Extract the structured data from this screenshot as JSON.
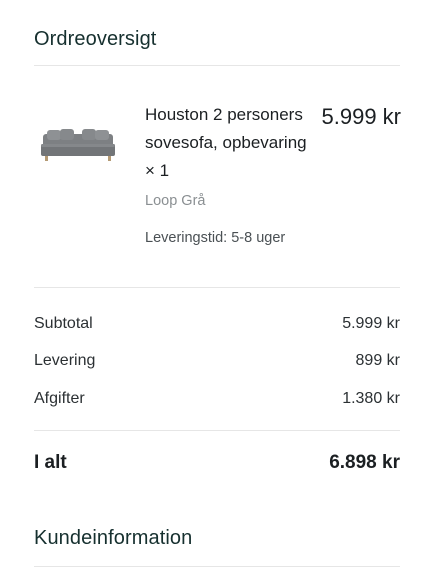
{
  "order_overview": {
    "title": "Ordreoversigt"
  },
  "product": {
    "image_icon": "sofa-bed-image",
    "name": "Houston 2 personers sovesofa, opbevaring × 1",
    "price": "5.999 kr",
    "variant": "Loop Grå",
    "delivery_time": "Leveringstid: 5-8 uger"
  },
  "summary": {
    "subtotal_label": "Subtotal",
    "subtotal_value": "5.999 kr",
    "delivery_label": "Levering",
    "delivery_value": "899 kr",
    "fees_label": "Afgifter",
    "fees_value": "1.380 kr",
    "total_label": "I alt",
    "total_value": "6.898 kr"
  },
  "customer_info": {
    "title": "Kundeinformation"
  }
}
